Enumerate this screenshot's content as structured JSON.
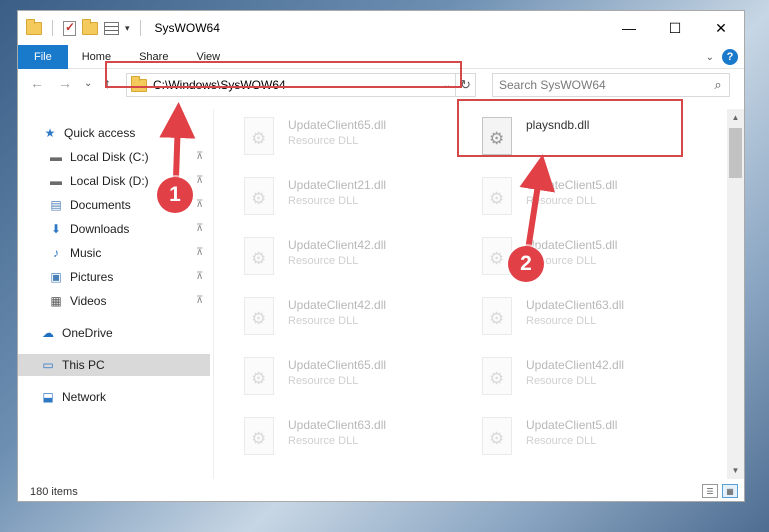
{
  "window": {
    "title": "SysWOW64",
    "controls": {
      "minimize": "—",
      "maximize": "☐",
      "close": "✕"
    }
  },
  "ribbon": {
    "tabs": [
      "File",
      "Home",
      "Share",
      "View"
    ],
    "collapse": "⌄",
    "help": "?"
  },
  "nav": {
    "back": "←",
    "forward": "→",
    "recent": "⌄",
    "up": "↑",
    "address": "C:\\Windows\\SysWOW64",
    "address_dropdown": "⌄",
    "refresh": "↻",
    "search_placeholder": "Search SysWOW64",
    "search_icon": "⌕"
  },
  "sidebar": {
    "items": [
      {
        "label": "Quick access",
        "icon": "star-icon",
        "glyph": "★",
        "color": "#2f78c4",
        "pinned": false
      },
      {
        "label": "Local Disk (C:)",
        "icon": "drive-icon",
        "glyph": "▬",
        "color": "#6b6b6b",
        "pinned": true
      },
      {
        "label": "Local Disk (D:)",
        "icon": "drive-icon",
        "glyph": "▬",
        "color": "#6b6b6b",
        "pinned": true
      },
      {
        "label": "Documents",
        "icon": "documents-icon",
        "glyph": "▤",
        "color": "#4a7fb8",
        "pinned": true
      },
      {
        "label": "Downloads",
        "icon": "downloads-icon",
        "glyph": "⬇",
        "color": "#2f78c4",
        "pinned": true
      },
      {
        "label": "Music",
        "icon": "music-icon",
        "glyph": "♪",
        "color": "#2f78c4",
        "pinned": true
      },
      {
        "label": "Pictures",
        "icon": "pictures-icon",
        "glyph": "▣",
        "color": "#4a7fb8",
        "pinned": true
      },
      {
        "label": "Videos",
        "icon": "videos-icon",
        "glyph": "▦",
        "color": "#555555",
        "pinned": true
      },
      {
        "label": "OneDrive",
        "icon": "onedrive-icon",
        "glyph": "☁",
        "color": "#1f6fc1",
        "pinned": false
      },
      {
        "label": "This PC",
        "icon": "this-pc-icon",
        "glyph": "▭",
        "color": "#2f78c4",
        "pinned": false,
        "selected": true
      },
      {
        "label": "Network",
        "icon": "network-icon",
        "glyph": "⬓",
        "color": "#2f78c4",
        "pinned": false
      }
    ],
    "pin_glyph": "📌"
  },
  "files": [
    {
      "name": "UpdateClient65.dll",
      "type": "Resource DLL",
      "faded": true
    },
    {
      "name": "playsndb.dll",
      "type": "",
      "faded": false
    },
    {
      "name": "UpdateClient21.dll",
      "type": "Resource DLL",
      "faded": true
    },
    {
      "name": "UpdateClient5.dll",
      "type": "Resource DLL",
      "faded": true
    },
    {
      "name": "UpdateClient42.dll",
      "type": "Resource DLL",
      "faded": true
    },
    {
      "name": "UpdateClient5.dll",
      "type": "Resource DLL",
      "faded": true
    },
    {
      "name": "UpdateClient42.dll",
      "type": "Resource DLL",
      "faded": true
    },
    {
      "name": "UpdateClient63.dll",
      "type": "Resource DLL",
      "faded": true
    },
    {
      "name": "UpdateClient65.dll",
      "type": "Resource DLL",
      "faded": true
    },
    {
      "name": "UpdateClient42.dll",
      "type": "Resource DLL",
      "faded": true
    },
    {
      "name": "UpdateClient63.dll",
      "type": "Resource DLL",
      "faded": true
    },
    {
      "name": "UpdateClient5.dll",
      "type": "Resource DLL",
      "faded": true
    }
  ],
  "status": {
    "item_count": "180 items"
  },
  "annotations": {
    "step1": "1",
    "step2": "2",
    "accent_color": "#e04046"
  }
}
